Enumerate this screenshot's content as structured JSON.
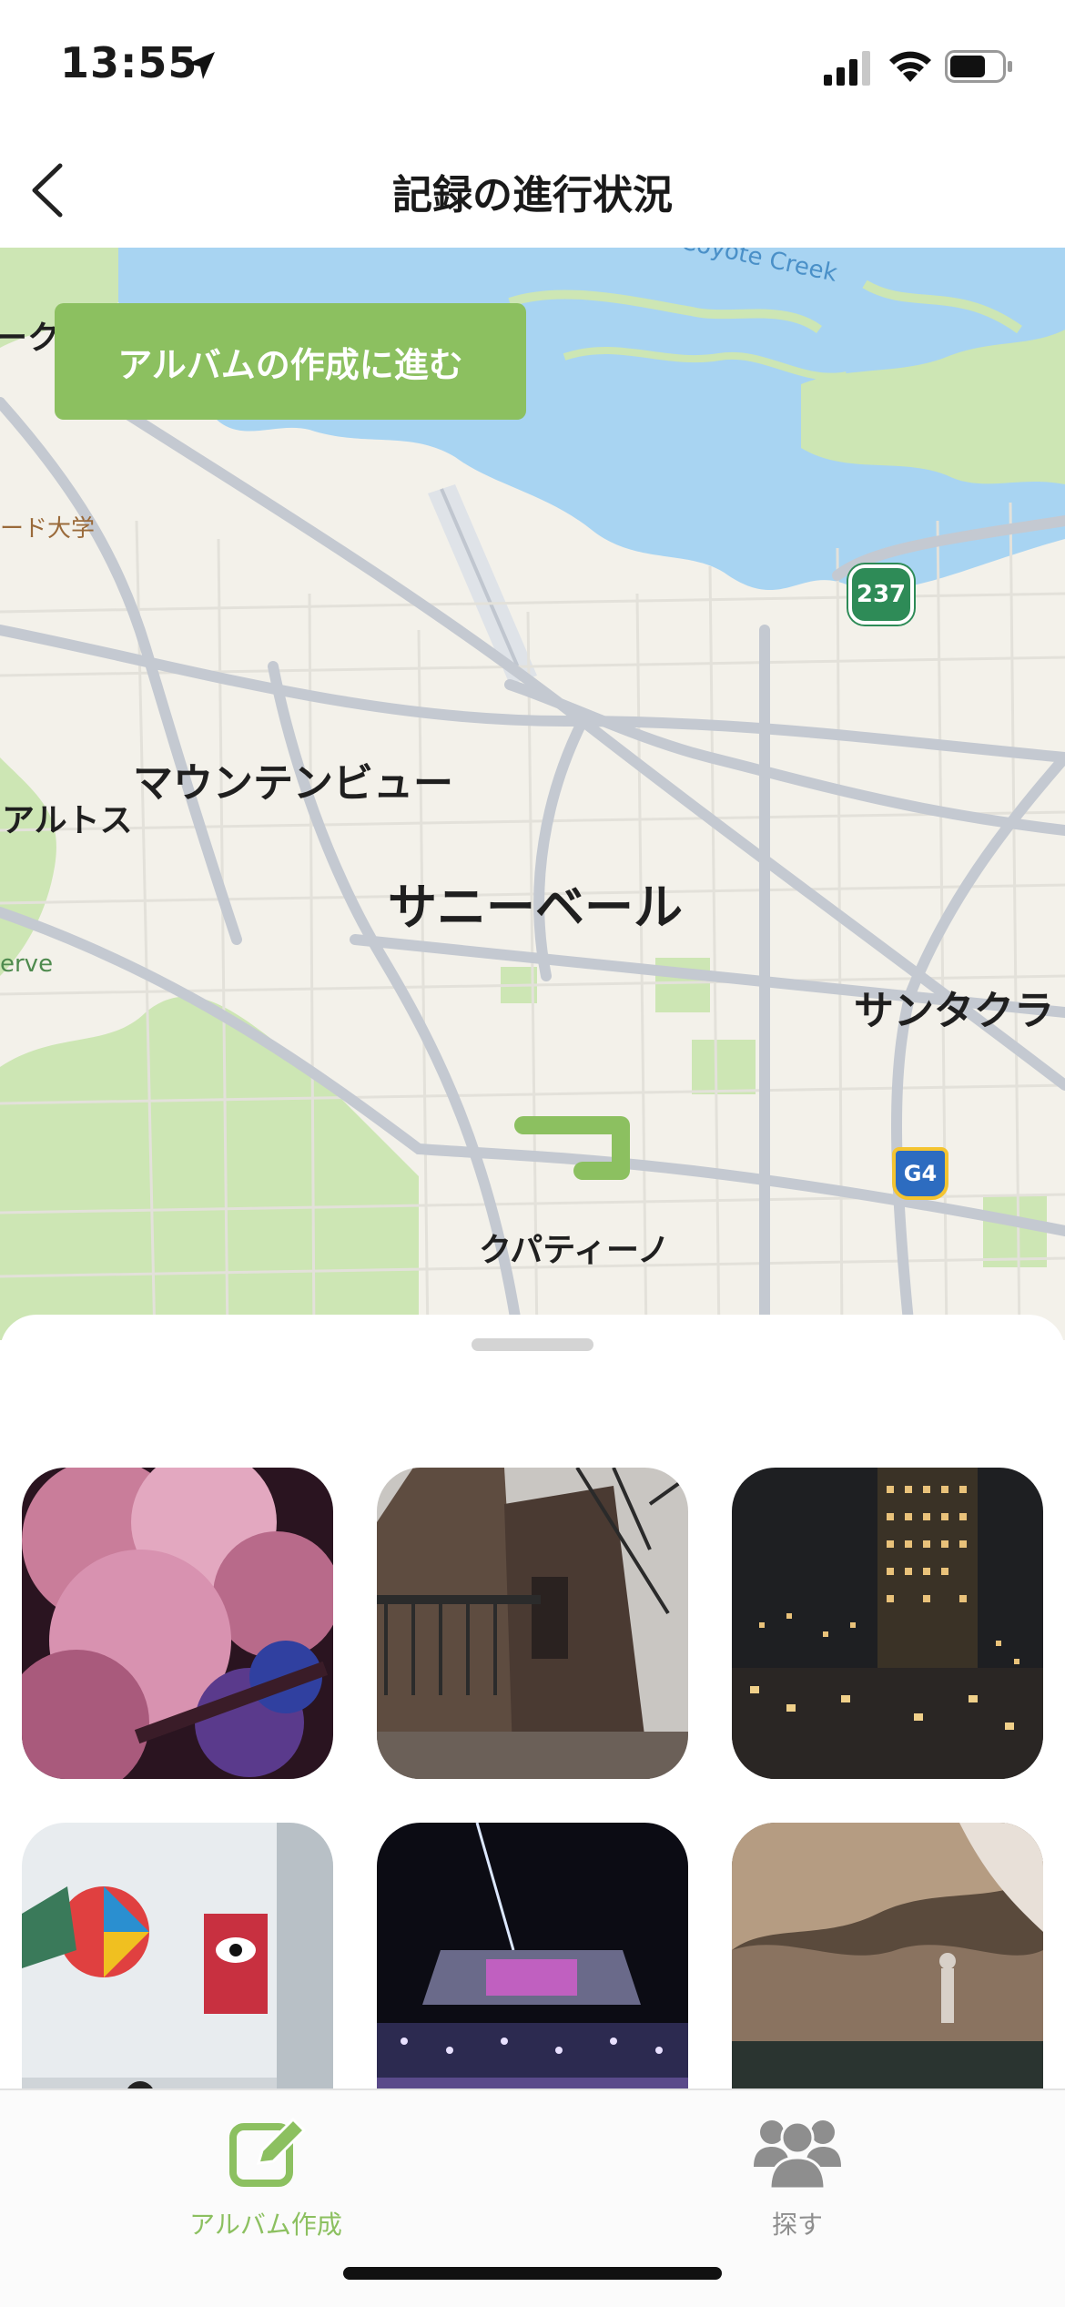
{
  "status_bar": {
    "time": "13:55",
    "icons": [
      "location-arrow-icon",
      "cellular-signal-icon",
      "wifi-icon",
      "battery-icon"
    ]
  },
  "nav": {
    "title": "記録の進行状況",
    "back_icon": "chevron-left-icon"
  },
  "map": {
    "labels": {
      "creek": "Coyote Creek",
      "university": "ード大学",
      "mountain_view": "マウンテンビュー",
      "los_altos": "アルトス",
      "sunnyvale": "サニーベール",
      "preserve": "erve",
      "santa_clara": "サンタクラ",
      "cupertino": "クパティーノ",
      "partial_top": "ーク"
    },
    "route_shields": [
      "237",
      "G4"
    ],
    "colors": {
      "water": "#a8d4f2",
      "park": "#cde6b4",
      "route": "#8cc060"
    }
  },
  "actions": {
    "album_button": "アルバムの作成に進む"
  },
  "photos": [
    {
      "name": "cherry-blossoms-photo"
    },
    {
      "name": "cathedral-photo"
    },
    {
      "name": "city-night-photo"
    },
    {
      "name": "gallery-art-photo"
    },
    {
      "name": "night-event-photo"
    },
    {
      "name": "cave-photo"
    }
  ],
  "tabs": [
    {
      "label": "アルバム作成",
      "icon": "edit-square-icon",
      "active": true
    },
    {
      "label": "探す",
      "icon": "people-group-icon",
      "active": false
    }
  ],
  "accent_color": "#8cc060"
}
